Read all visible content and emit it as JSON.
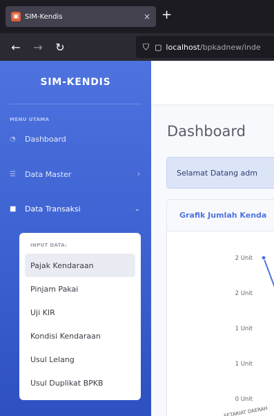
{
  "browser": {
    "tab_title": "SIM-Kendis",
    "tab_close": "×",
    "new_tab": "+",
    "url_host": "localhost",
    "url_path": "/bpkadnew/inde"
  },
  "sidebar": {
    "brand": "SIM-KENDIS",
    "section": "MENU UTAMA",
    "items": [
      {
        "label": "Dashboard",
        "icon": "dashboard-icon"
      },
      {
        "label": "Data Master",
        "icon": "database-icon"
      },
      {
        "label": "Data Transaksi",
        "icon": "briefcase-icon"
      }
    ],
    "submenu": {
      "heading": "INPUT DATA:",
      "items": [
        {
          "label": "Pajak Kendaraan"
        },
        {
          "label": "Pinjam Pakai"
        },
        {
          "label": "Uji KIR"
        },
        {
          "label": "Kondisi Kendaraan"
        },
        {
          "label": "Usul Lelang"
        },
        {
          "label": "Usul Duplikat BPKB"
        }
      ]
    }
  },
  "main": {
    "title": "Dashboard",
    "alert": "Selamat Datang adm",
    "card_title": "Grafik Jumlah Kenda"
  },
  "chart_data": {
    "type": "line",
    "title": "Grafik Jumlah Kenda",
    "y_tick_labels": [
      "2 Unit",
      "2 Unit",
      "1 Unit",
      "1 Unit",
      "0 Unit"
    ],
    "y_ticks": [
      2,
      1.5,
      1,
      0.5,
      0
    ],
    "ylim": [
      0,
      2
    ],
    "x": [
      "SETARIAT DAERAH"
    ],
    "series": [
      {
        "values": [
          2
        ]
      }
    ],
    "color": "#4e73df",
    "grid": false
  },
  "colors": {
    "sidebar": "#4e73df",
    "accent": "#4e73df",
    "submenu_active": "#eaecf4"
  }
}
